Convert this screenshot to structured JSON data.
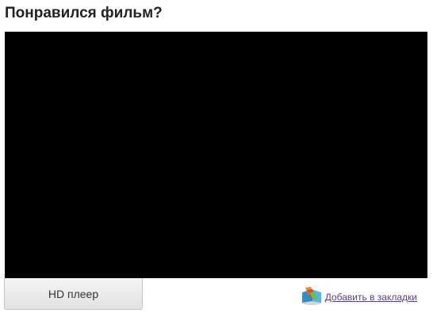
{
  "header": {
    "title": "Понравился фильм?"
  },
  "player": {
    "hd_button_label": "HD плеер"
  },
  "bookmark": {
    "label": "Добавить в закладки",
    "icon": "bookmark-icon"
  },
  "colors": {
    "player_background": "#000000",
    "link": "#5a3d9a"
  }
}
